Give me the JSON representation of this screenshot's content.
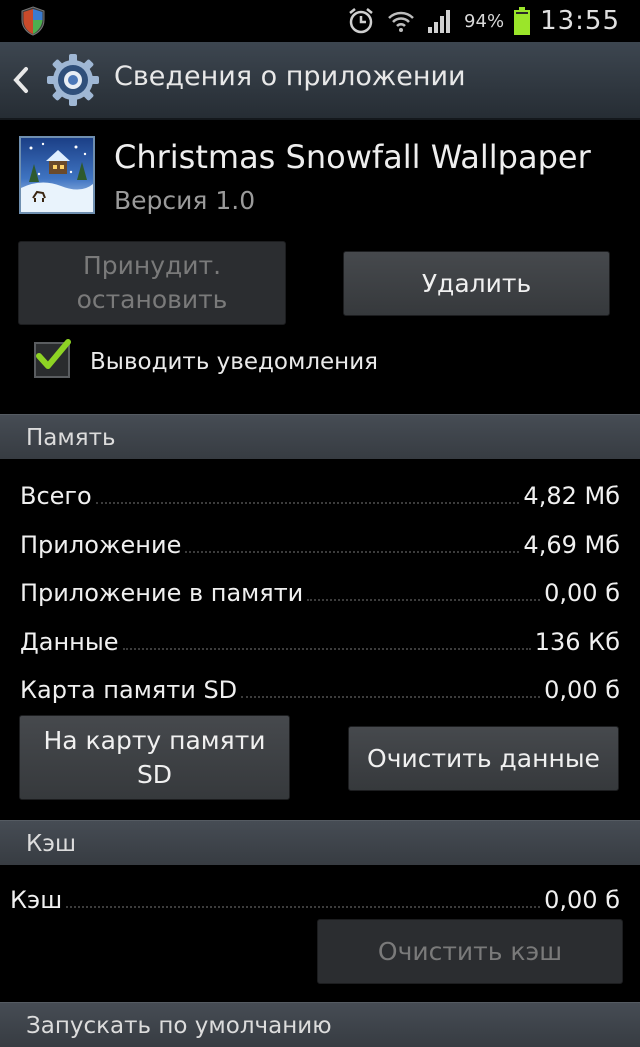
{
  "status_bar": {
    "battery_percent": "94%",
    "time": "13:55",
    "icons": [
      "shield-icon",
      "alarm-icon",
      "wifi-icon",
      "signal-icon",
      "battery-icon"
    ]
  },
  "action_bar": {
    "title": "Сведения о приложении"
  },
  "app": {
    "name": "Christmas Snowfall Wallpaper",
    "version": "Версия 1.0"
  },
  "buttons": {
    "force_stop": "Принудит. остановить",
    "uninstall": "Удалить",
    "move_to_sd": "На карту памяти SD",
    "clear_data": "Очистить данные",
    "clear_cache": "Очистить кэш"
  },
  "notifications": {
    "label": "Выводить уведомления",
    "checked": true
  },
  "storage": {
    "header": "Память",
    "rows": [
      {
        "label": "Всего",
        "value": "4,82 Мб"
      },
      {
        "label": "Приложение",
        "value": "4,69 Мб"
      },
      {
        "label": "Приложение в памяти",
        "value": "0,00 б"
      },
      {
        "label": "Данные",
        "value": "136 Кб"
      },
      {
        "label": "Карта памяти SD",
        "value": "0,00 б"
      }
    ]
  },
  "cache": {
    "header": "Кэш",
    "row": {
      "label": "Кэш",
      "value": "0,00 б"
    }
  },
  "launch_defaults": {
    "header": "Запускать по умолчанию"
  },
  "colors": {
    "accent_check": "#8ed324",
    "section_bg": "#3f454c",
    "battery": "#9be52a"
  }
}
